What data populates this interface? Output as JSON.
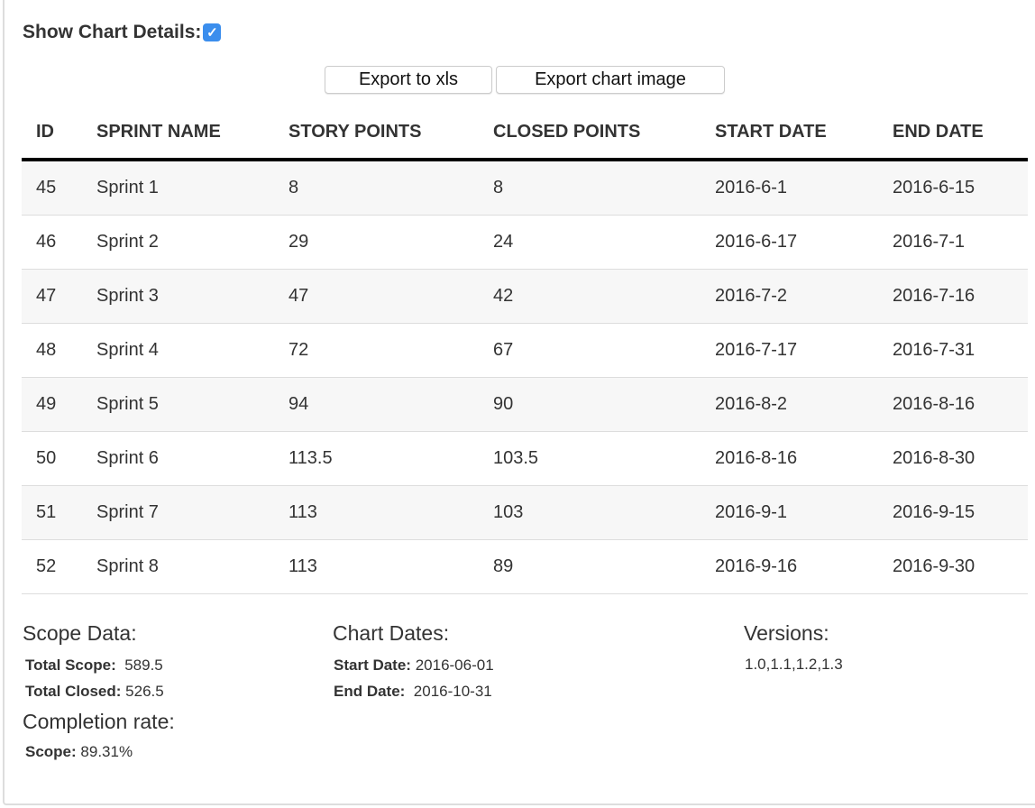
{
  "show_details": {
    "label": "Show Chart Details:",
    "checked": true,
    "check_glyph": "✓"
  },
  "toolbar": {
    "export_xls": "Export to xls",
    "export_image": "Export chart image"
  },
  "table": {
    "headers": [
      "ID",
      "SPRINT NAME",
      "STORY POINTS",
      "CLOSED POINTS",
      "START DATE",
      "END DATE"
    ],
    "rows": [
      [
        "45",
        "Sprint 1",
        "8",
        "8",
        "2016-6-1",
        "2016-6-15"
      ],
      [
        "46",
        "Sprint 2",
        "29",
        "24",
        "2016-6-17",
        "2016-7-1"
      ],
      [
        "47",
        "Sprint 3",
        "47",
        "42",
        "2016-7-2",
        "2016-7-16"
      ],
      [
        "48",
        "Sprint 4",
        "72",
        "67",
        "2016-7-17",
        "2016-7-31"
      ],
      [
        "49",
        "Sprint 5",
        "94",
        "90",
        "2016-8-2",
        "2016-8-16"
      ],
      [
        "50",
        "Sprint 6",
        "113.5",
        "103.5",
        "2016-8-16",
        "2016-8-30"
      ],
      [
        "51",
        "Sprint 7",
        "113",
        "103",
        "2016-9-1",
        "2016-9-15"
      ],
      [
        "52",
        "Sprint 8",
        "113",
        "89",
        "2016-9-16",
        "2016-9-30"
      ]
    ]
  },
  "scope": {
    "title": "Scope Data:",
    "total_scope_label": "Total Scope:",
    "total_scope": "589.5",
    "total_closed_label": "Total Closed:",
    "total_closed": "526.5"
  },
  "completion": {
    "title": "Completion rate:",
    "scope_label": "Scope:",
    "scope": "89.31%"
  },
  "dates": {
    "title": "Chart Dates:",
    "start_label": "Start Date:",
    "start": "2016-06-01",
    "end_label": "End Date:",
    "end": "2016-10-31"
  },
  "versions": {
    "title": "Versions:",
    "value": "1.0,1.1,1.2,1.3"
  },
  "colors": {
    "checkbox": "#3b8eed"
  }
}
